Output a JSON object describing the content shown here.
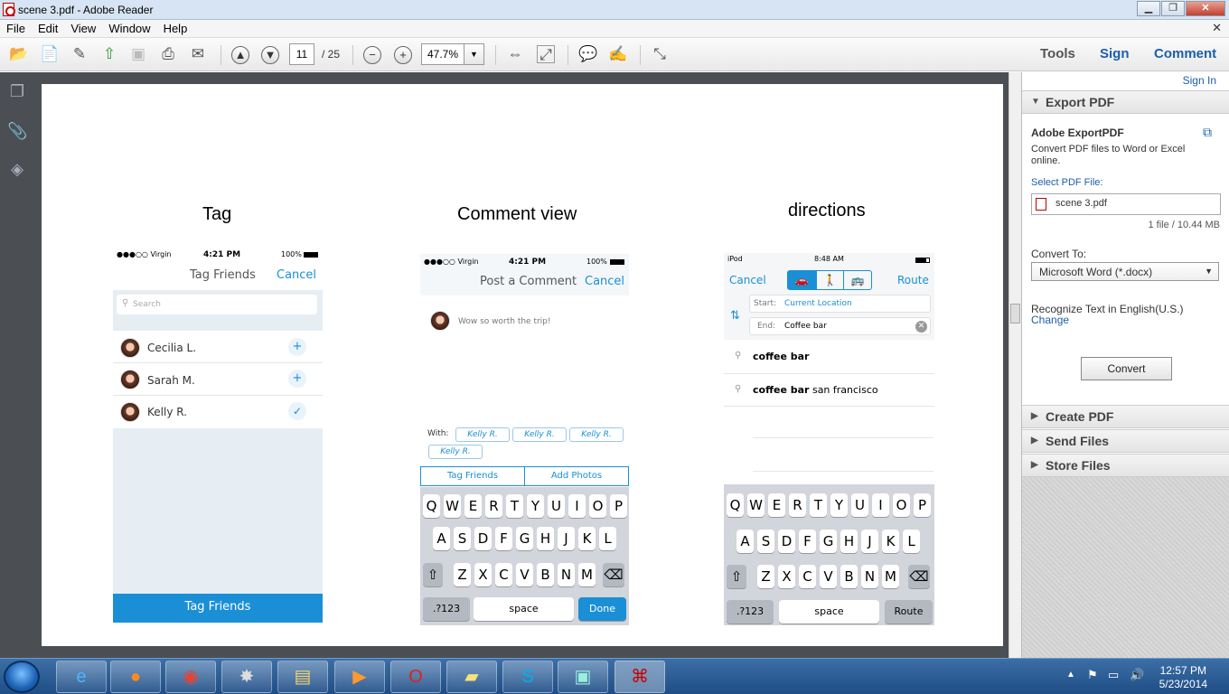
{
  "window": {
    "title": "scene 3.pdf - Adobe Reader"
  },
  "menu": [
    "File",
    "Edit",
    "View",
    "Window",
    "Help"
  ],
  "toolbar": {
    "page": "11",
    "total": "/ 25",
    "zoom": "47.7%"
  },
  "tabs": {
    "tools": "Tools",
    "sign": "Sign",
    "comment": "Comment"
  },
  "rpanel": {
    "signin": "Sign In",
    "export_pdf": "Export PDF",
    "export_title": "Adobe ExportPDF",
    "export_desc": "Convert PDF files to Word or Excel online.",
    "select_label": "Select PDF File:",
    "file_name": "scene 3.pdf",
    "file_info": "1 file / 10.44 MB",
    "convert_to_label": "Convert To:",
    "convert_to_value": "Microsoft Word (*.docx)",
    "recognize": "Recognize Text in English(U.S.)",
    "change": "Change",
    "convert_btn": "Convert",
    "create_pdf": "Create PDF",
    "send_files": "Send Files",
    "store_files": "Store Files"
  },
  "doc": {
    "tag": {
      "caption": "Tag",
      "status_carrier": "●●●○○ Virgin",
      "status_time": "4:21 PM",
      "status_battery": "100%",
      "title": "Tag Friends",
      "cancel": "Cancel",
      "search": "Search",
      "people": [
        {
          "name": "Cecilia L.",
          "state": "+"
        },
        {
          "name": "Sarah M.",
          "state": "+"
        },
        {
          "name": "Kelly R.",
          "state": "✓"
        }
      ],
      "button": "Tag Friends"
    },
    "comment": {
      "caption": "Comment view",
      "status_carrier": "●●●○○ Virgin",
      "status_time": "4:21 PM",
      "status_battery": "100%",
      "title": "Post a Comment",
      "cancel": "Cancel",
      "text": "Wow so worth the trip!",
      "with": "With:",
      "tags": [
        "Kelly R.",
        "Kelly R.",
        "Kelly R.",
        "Kelly R."
      ],
      "tab1": "Tag Friends",
      "tab2": "Add Photos",
      "done": "Done"
    },
    "directions": {
      "caption": "directions",
      "status_carrier": "iPod",
      "status_time": "8:48 AM",
      "cancel": "Cancel",
      "route": "Route",
      "start_label": "Start:",
      "start_value": "Current Location",
      "end_label": "End:",
      "end_value": "Coffee bar",
      "results": [
        {
          "bold": "coffee bar",
          "rest": ""
        },
        {
          "bold": "coffee bar",
          "rest": " san francisco"
        }
      ],
      "route_key": "Route"
    },
    "keyboard": {
      "row1": [
        "Q",
        "W",
        "E",
        "R",
        "T",
        "Y",
        "U",
        "I",
        "O",
        "P"
      ],
      "row2": [
        "A",
        "S",
        "D",
        "F",
        "G",
        "H",
        "J",
        "K",
        "L"
      ],
      "row3": [
        "Z",
        "X",
        "C",
        "V",
        "B",
        "N",
        "M"
      ],
      "numbers": ".?123",
      "space": "space"
    }
  },
  "taskbar": {
    "time": "12:57 PM",
    "date": "5/23/2014"
  }
}
